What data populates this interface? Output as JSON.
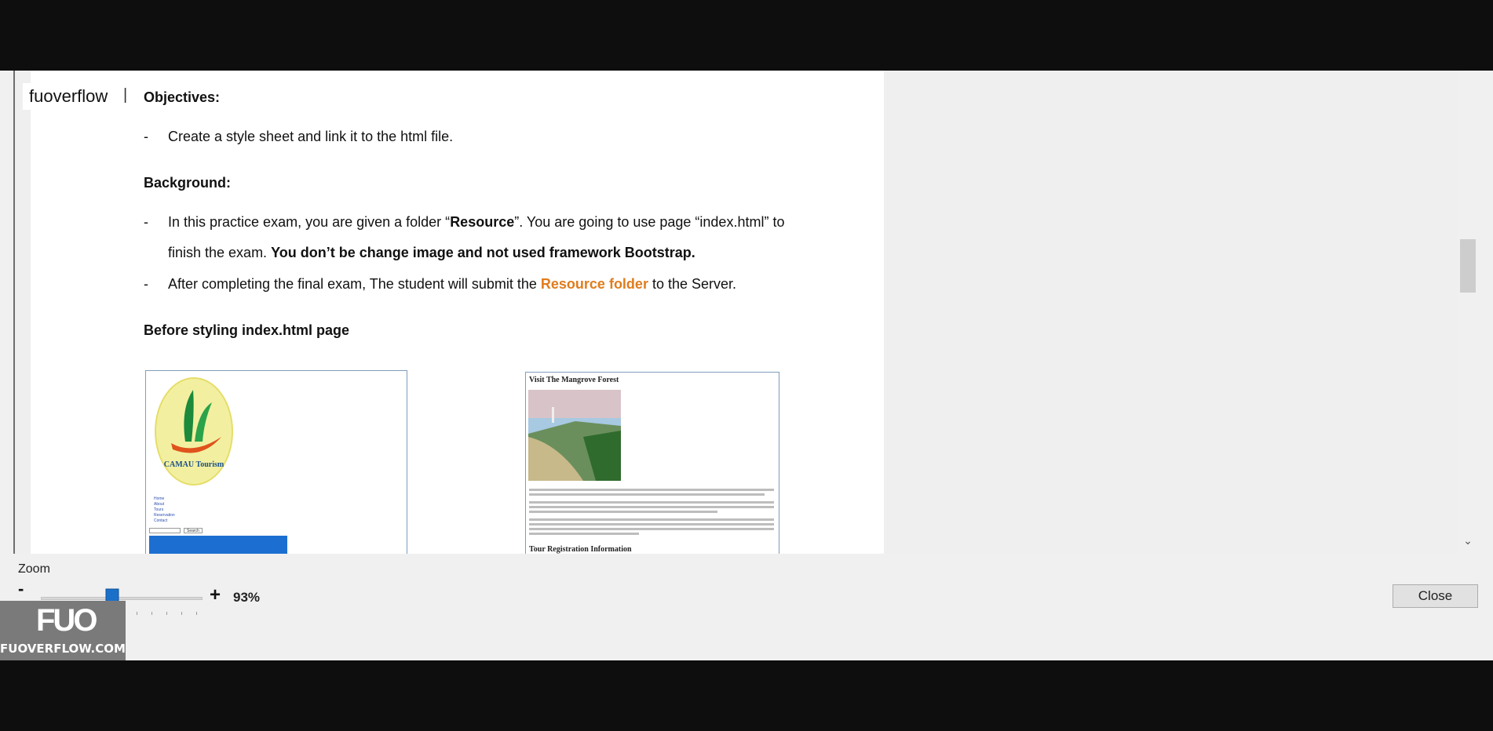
{
  "watermark": {
    "brand": "fuoverflow",
    "separator": "|"
  },
  "document": {
    "objectives_heading": "Objectives:",
    "objectives": [
      {
        "dash": "-",
        "text": "Create a style sheet and link it to the html file."
      }
    ],
    "background_heading": "Background:",
    "background_item1": {
      "dash": "-",
      "line1_a": "In this practice exam, you are given a folder “",
      "line1_b": "Resource",
      "line1_c": "”. You are going to use page “index.html”  to",
      "line2_a": "finish the exam. ",
      "line2_b": "You don’t be change image and not used framework Bootstrap."
    },
    "background_item2": {
      "dash": "-",
      "text_a": "After completing the final exam, The student will submit the ",
      "text_b": "Resource folder",
      "text_c": " to the Server."
    },
    "before_heading": "Before styling index.html page",
    "preview_logo_text": "CAMAU Tourism",
    "preview_right_title": "Visit The Mangrove Forest",
    "preview_right_subtitle": "Tour Registration Information",
    "preview_nav": [
      "Home",
      "About",
      "Tours",
      "Reservation",
      "Contact"
    ],
    "preview_search_button": "Search"
  },
  "zoom": {
    "label": "Zoom",
    "minus": "-",
    "plus": "+",
    "value_text": "93%",
    "level_fraction": 0.4
  },
  "buttons": {
    "close": "Close"
  },
  "logo": {
    "mark": "FUO",
    "site": "FUOVERFLOW.COM"
  },
  "colors": {
    "accent_orange": "#e07c1c",
    "slider_thumb": "#1a6fc9",
    "logo_bg": "#7a7a7a"
  }
}
